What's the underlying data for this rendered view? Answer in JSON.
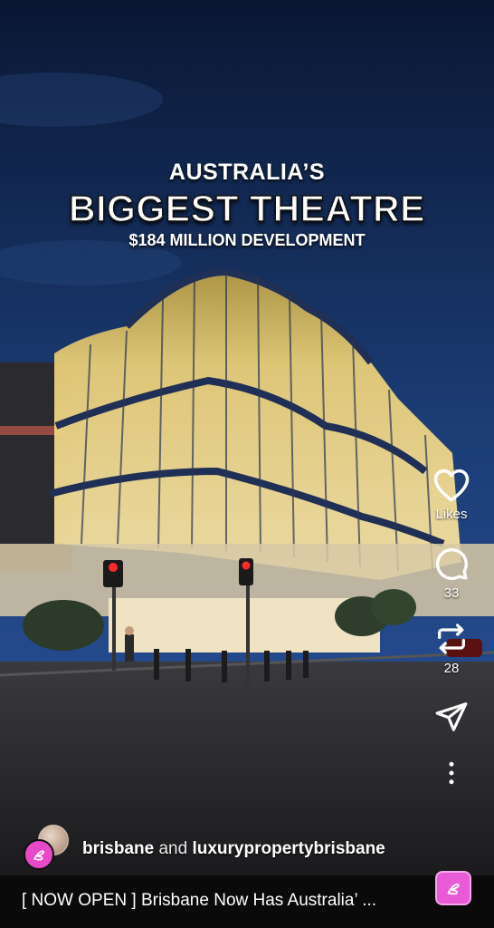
{
  "overlay": {
    "line1": "AUSTRALIA’S",
    "line2": "BIGGEST THEATRE",
    "line3": "$184 MILLION DEVELOPMENT"
  },
  "actions": {
    "like": {
      "icon": "heart-icon",
      "label": "Likes"
    },
    "comment": {
      "icon": "comment-icon",
      "count": "33"
    },
    "repost": {
      "icon": "repost-icon",
      "count": "28"
    },
    "share": {
      "icon": "send-icon"
    },
    "more": {
      "icon": "more-vertical-icon"
    }
  },
  "author": {
    "name1": "brisbane",
    "joiner": "and",
    "name2": "luxurypropertybrisbane"
  },
  "caption": {
    "text": "[ NOW OPEN ] Brisbane Now Has Australia’ ..."
  },
  "colors": {
    "sky_top": "#0b1c3a",
    "sky_bottom": "#1d3f7a",
    "building_glow": "#f3d88a",
    "accent_pink": "#e948c8"
  }
}
